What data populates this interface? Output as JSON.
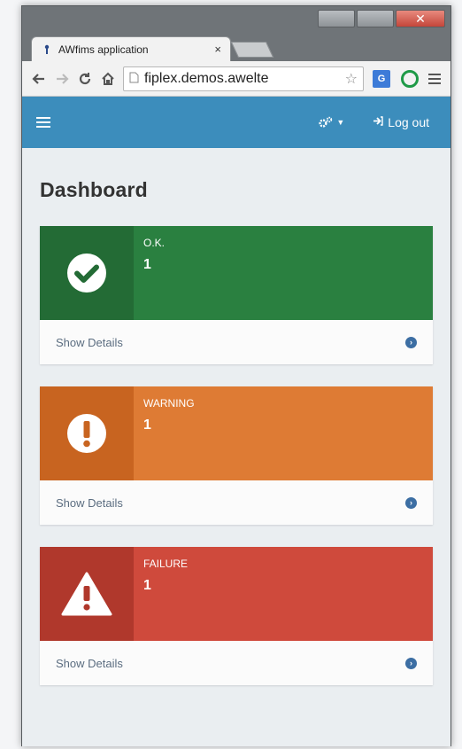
{
  "browser": {
    "tab_title": "AWfims application",
    "tab_close": "×",
    "url": "fiplex.demos.awelte",
    "window_close": "✕"
  },
  "navbar": {
    "logout_label": "Log out"
  },
  "page": {
    "title": "Dashboard"
  },
  "cards": [
    {
      "label": "O.K.",
      "value": "1",
      "footer": "Show Details",
      "color": "#2a8040",
      "icon_bg": "#236b35",
      "icon": "check-circle-icon"
    },
    {
      "label": "WARNING",
      "value": "1",
      "footer": "Show Details",
      "color": "#de7b34",
      "icon_bg": "#c86420",
      "icon": "exclamation-circle-icon"
    },
    {
      "label": "FAILURE",
      "value": "1",
      "footer": "Show Details",
      "color": "#cf4a3c",
      "icon_bg": "#b0382c",
      "icon": "warning-triangle-icon"
    }
  ]
}
